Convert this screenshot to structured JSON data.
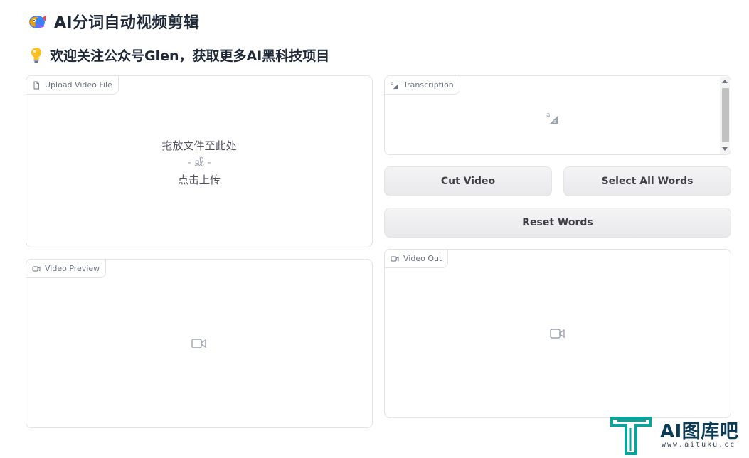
{
  "header": {
    "title": "AI分词自动视频剪辑",
    "subtitle": "欢迎关注公众号Glen，获取更多AI黑科技项目",
    "logo_icon": "fish-logo-icon",
    "subtitle_icon": "lightbulb-icon"
  },
  "upload": {
    "label": "Upload Video File",
    "drop_text": "拖放文件至此处",
    "or_text": "- 或 -",
    "click_text": "点击上传"
  },
  "preview": {
    "label": "Video Preview"
  },
  "transcription": {
    "label": "Transcription"
  },
  "buttons": {
    "cut": "Cut Video",
    "select_all": "Select All Words",
    "reset": "Reset Words"
  },
  "video_out": {
    "label": "Video Out"
  },
  "watermark": {
    "brand": "AI图库吧",
    "url": "www.aituku.cc",
    "color": "#0aa39a"
  }
}
